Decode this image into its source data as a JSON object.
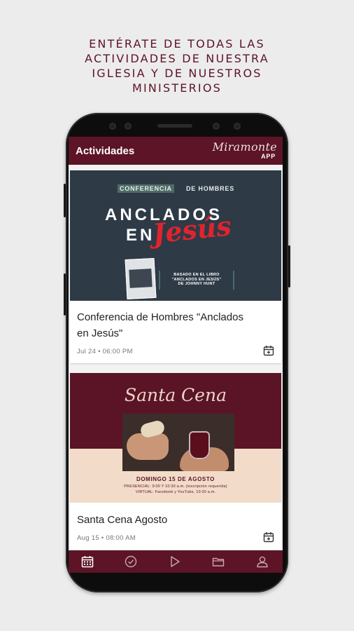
{
  "headline": {
    "line1": "ENTÉRATE DE TODAS LAS",
    "line2": "ACTIVIDADES DE NUESTRA",
    "line3": "IGLESIA Y DE NUESTROS",
    "line4": "MINISTERIOS"
  },
  "appbar": {
    "title": "Actividades",
    "logo_script": "Miramonte",
    "logo_app": "APP"
  },
  "events": [
    {
      "title_line1": "Conferencia de Hombres \"Anclados",
      "title_line2": "en Jesús\"",
      "date": "Jul 24 • 06:00 PM",
      "banner": {
        "tag_highlight": "CONFERENCIA",
        "tag_rest": "DE HOMBRES",
        "line1": "ANCLADOS",
        "line2": "EN",
        "script": "Jesús",
        "caption_line1": "BASADO EN EL LIBRO",
        "caption_line2": "\"ANCLADOS EN JESÚS\"",
        "caption_line3": "DE JOHNNY HUNT",
        "book_label": "ANCLADOS"
      }
    },
    {
      "title_line1": "Santa Cena Agosto",
      "date": "Aug 15 • 08:00 AM",
      "banner": {
        "script": "Santa Cena",
        "sunday": "DOMINGO 15 DE AGOSTO",
        "line1": "PRESENCIAL: 9:00 Y 10:30 a.m. (inscripción requerida)",
        "line2": "VIRTUAL: Facebook y YouTube, 10:30 a.m."
      }
    }
  ],
  "bottom_nav": [
    {
      "icon": "calendar-icon",
      "active": true
    },
    {
      "icon": "check-circle-icon",
      "active": false
    },
    {
      "icon": "play-icon",
      "active": false
    },
    {
      "icon": "folder-icon",
      "active": false
    },
    {
      "icon": "user-icon",
      "active": false
    }
  ],
  "colors": {
    "brand": "#5c1426",
    "background": "#ececec",
    "accent_red": "#e0242e"
  }
}
